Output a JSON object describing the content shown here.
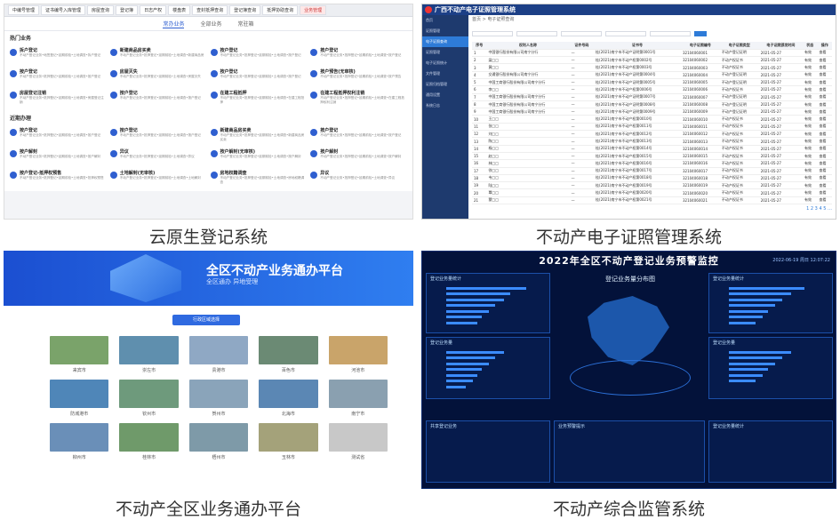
{
  "panel1": {
    "tabs": [
      "中编号管理",
      "证书编号入库管理",
      "房屋查询",
      "登记簿",
      "日志产权",
      "楼盘表",
      "查封抵押查询",
      "登记簿查询",
      "抵押协助查询",
      "业务管理"
    ],
    "subnav": [
      "常办业务",
      "全部业务",
      "常驻箱"
    ],
    "hot_title": "热门业务",
    "hot_items": [
      {
        "t": "拆户登记",
        "d": "不动产登记业务•地签登记•延期前检•土地调查•拆户登记"
      },
      {
        "t": "新建商品房买卖",
        "d": "不动产登记业务•抵押登记•延期前检•土地调查•新建商品房"
      },
      {
        "t": "按户登记",
        "d": "不动产登记业务•抵押登记•延期前检•土地调查•按户登记"
      },
      {
        "t": "按户登记",
        "d": "不动产登记业务•抵押登记•延期前检•土地调查•按户登记"
      },
      {
        "t": "按户登记",
        "d": "不动产登记业务•抵押登记•延期前检•土地调查•按户登记"
      },
      {
        "t": "房屋灭失",
        "d": "不动产登记业务•抵押登记•延期前检•土地调查•房屋灭失"
      },
      {
        "t": "按户登记",
        "d": "不动产登记业务•抵押登记•延期前检•土地调查•按户登记"
      },
      {
        "t": "按户预告(无审核)",
        "d": "不动产登记业务•抵押登记•延期前检•土地调查•按户预告"
      },
      {
        "t": "房屋登记注销",
        "d": "不动产登记业务•抵押登记•延期前检•土地调查•房屋登记注销"
      },
      {
        "t": "按户登记",
        "d": "不动产登记业务•抵押登记•延期前检•土地调查•按户登记"
      },
      {
        "t": "在建工程抵押",
        "d": "不动产登记业务•抵押登记•延期前检•土地调查•在建工程抵押"
      },
      {
        "t": "在建工程抵押权利注销",
        "d": "不动产登记业务•抵押登记•延期前检•土地调查•在建工程抵押权利注销"
      }
    ],
    "recent_title": "近期办理",
    "recent_items": [
      {
        "t": "按户登记",
        "d": "不动产登记业务•抵押登记•延期前检•土地调查•按户登记"
      },
      {
        "t": "按户登记",
        "d": "不动产登记业务•抵押登记•延期前检•土地调查•按户登记"
      },
      {
        "t": "新建商品房买卖",
        "d": "不动产登记业务•抵押登记•延期前检•土地调查•新建商品房买卖"
      },
      {
        "t": "按户登记",
        "d": "不动产登记业务•抵押登记•延期前检•土地调查•按户登记"
      },
      {
        "t": "按户解封",
        "d": "不动产登记业务•抵押登记•延期前检•土地调查•按户解封"
      },
      {
        "t": "异议",
        "d": "不动产登记业务•抵押登记•延期前检•土地调查•异议"
      },
      {
        "t": "按户解封(无审核)",
        "d": "不动产登记业务•抵押登记•延期前检•土地调查•按户解封"
      },
      {
        "t": "按户解封",
        "d": "不动产登记业务•抵押登记•延期前检•土地调查•按户解封"
      },
      {
        "t": "按户登记-抵押权预售",
        "d": "不动产登记业务•抵押登记•延期前检•土地调查•抵押权预售"
      },
      {
        "t": "土地解封(无审核)",
        "d": "不动产登记业务•抵押登记•延期前检•土地调查•土地解封"
      },
      {
        "t": "房地权籍调查",
        "d": "不动产登记业务•抵押登记•延期前检•土地调查•房地权籍调查"
      },
      {
        "t": "异议",
        "d": "不动产登记业务•抵押登记•延期前检•土地调查•异议"
      }
    ]
  },
  "panel2": {
    "title": "广西不动产电子证照管理系统",
    "side": [
      "首页",
      "证照管理",
      "电子证照查询",
      "证照管理",
      "电子证照统计",
      "文件管理",
      "证照归档管理",
      "通用设置",
      "系统日志"
    ],
    "side_active": 2,
    "crumb": "首页 > 电子证照查询",
    "headers": [
      "序号",
      "权利人名称",
      "证件号码",
      "证书号",
      "电子证照编号",
      "电子证照类型",
      "电子证照颁发时间",
      "状态",
      "操作"
    ],
    "rows": [
      [
        "1",
        "中国银行股份有限公司南宁分行",
        "—",
        "桂(2021)南宁市不动产证明第0001号",
        "32104060001",
        "不动产登记证明",
        "2021-05-27",
        "有效",
        "查看"
      ],
      [
        "2",
        "梁□□",
        "—",
        "桂(2021)南宁市不动产权第0002号",
        "32104060002",
        "不动产权证书",
        "2021-05-27",
        "有效",
        "查看"
      ],
      [
        "3",
        "黄□□",
        "—",
        "桂(2021)南宁市不动产权第0003号",
        "32104060003",
        "不动产权证书",
        "2021-05-27",
        "有效",
        "查看"
      ],
      [
        "4",
        "交通银行股份有限公司南宁分行",
        "—",
        "桂(2021)南宁市不动产证明第0004号",
        "32104060004",
        "不动产登记证明",
        "2021-05-27",
        "有效",
        "查看"
      ],
      [
        "5",
        "中国工商银行股份有限公司南宁分行",
        "—",
        "桂(2021)南宁市不动产证明第0005号",
        "32104060005",
        "不动产登记证明",
        "2021-05-27",
        "有效",
        "查看"
      ],
      [
        "6",
        "李□□",
        "—",
        "桂(2021)南宁市不动产权第0006号",
        "32104060006",
        "不动产权证书",
        "2021-05-27",
        "有效",
        "查看"
      ],
      [
        "7",
        "中国工商银行股份有限公司南宁分行",
        "—",
        "桂(2021)南宁市不动产证明第0007号",
        "32104060007",
        "不动产登记证明",
        "2021-05-27",
        "有效",
        "查看"
      ],
      [
        "8",
        "中国工商银行股份有限公司南宁分行",
        "—",
        "桂(2021)南宁市不动产证明第0008号",
        "32104060008",
        "不动产登记证明",
        "2021-05-27",
        "有效",
        "查看"
      ],
      [
        "9",
        "中国工商银行股份有限公司南宁分行",
        "—",
        "桂(2021)南宁市不动产证明第0009号",
        "32104060009",
        "不动产登记证明",
        "2021-05-27",
        "有效",
        "查看"
      ],
      [
        "10",
        "王□□",
        "—",
        "桂(2021)南宁市不动产权第0010号",
        "32104060010",
        "不动产权证书",
        "2021-05-27",
        "有效",
        "查看"
      ],
      [
        "11",
        "张□□",
        "—",
        "桂(2021)南宁市不动产权第0011号",
        "32104060011",
        "不动产权证书",
        "2021-05-27",
        "有效",
        "查看"
      ],
      [
        "12",
        "刘□□",
        "—",
        "桂(2021)南宁市不动产权第0012号",
        "32104060012",
        "不动产权证书",
        "2021-05-27",
        "有效",
        "查看"
      ],
      [
        "13",
        "陈□□",
        "—",
        "桂(2021)南宁市不动产权第0013号",
        "32104060013",
        "不动产权证书",
        "2021-05-27",
        "有效",
        "查看"
      ],
      [
        "14",
        "杨□□",
        "—",
        "桂(2021)南宁市不动产权第0014号",
        "32104060014",
        "不动产权证书",
        "2021-05-27",
        "有效",
        "查看"
      ],
      [
        "15",
        "赵□□",
        "—",
        "桂(2021)南宁市不动产权第0015号",
        "32104060015",
        "不动产权证书",
        "2021-05-27",
        "有效",
        "查看"
      ],
      [
        "16",
        "林□□",
        "—",
        "桂(2021)南宁市不动产权第0016号",
        "32104060016",
        "不动产权证书",
        "2021-05-27",
        "有效",
        "查看"
      ],
      [
        "17",
        "徐□□",
        "—",
        "桂(2021)南宁市不动产权第0017号",
        "32104060017",
        "不动产权证书",
        "2021-05-27",
        "有效",
        "查看"
      ],
      [
        "18",
        "韦□□",
        "—",
        "桂(2021)南宁市不动产权第0018号",
        "32104060018",
        "不动产权证书",
        "2021-05-27",
        "有效",
        "查看"
      ],
      [
        "19",
        "陆□□",
        "—",
        "桂(2021)南宁市不动产权第0019号",
        "32104060019",
        "不动产权证书",
        "2021-05-27",
        "有效",
        "查看"
      ],
      [
        "20",
        "覃□□",
        "—",
        "桂(2021)南宁市不动产权第0020号",
        "32104060020",
        "不动产权证书",
        "2021-05-27",
        "有效",
        "查看"
      ],
      [
        "21",
        "蒙□□",
        "—",
        "桂(2021)南宁市不动产权第0021号",
        "32104060021",
        "不动产权证书",
        "2021-05-27",
        "有效",
        "查看"
      ]
    ],
    "pager": "1 2 3 4 5 …"
  },
  "panel3": {
    "title": "全区不动产业务通办平台",
    "subtitle": "全区通办  异地受理",
    "pill": "行政区域选择",
    "cities": [
      {
        "name": "来宾市",
        "color": "#7aa36a"
      },
      {
        "name": "崇左市",
        "color": "#5f8fae"
      },
      {
        "name": "贵港市",
        "color": "#8fa8c4"
      },
      {
        "name": "百色市",
        "color": "#6b8a74"
      },
      {
        "name": "河池市",
        "color": "#c9a46a"
      },
      {
        "name": "防城港市",
        "color": "#4f86b8"
      },
      {
        "name": "钦州市",
        "color": "#6e9a7c"
      },
      {
        "name": "贺州市",
        "color": "#8aa4ba"
      },
      {
        "name": "北海市",
        "color": "#5b87b4"
      },
      {
        "name": "南宁市",
        "color": "#8aa0b0"
      },
      {
        "name": "柳州市",
        "color": "#6a8fb8"
      },
      {
        "name": "桂林市",
        "color": "#6f9a6a"
      },
      {
        "name": "梧州市",
        "color": "#7e9aa8"
      },
      {
        "name": "玉林市",
        "color": "#a4a27a"
      },
      {
        "name": "测试省",
        "color": "#c8c8c8"
      }
    ]
  },
  "panel4": {
    "title": "2022年全区不动产登记业务预警监控",
    "time": "2022-06-19 周日 12:07:22",
    "map_title": "登记业务量分布图",
    "left_boxes": [
      "登记业务量统计",
      "登记业务量",
      "共享登记业务"
    ],
    "right_boxes": [
      "登记业务量统计",
      "登记业务量",
      "登记业务量统计"
    ],
    "bottom_center": "业务预警提示",
    "left_bars": [
      0.9,
      0.72,
      0.65,
      0.55,
      0.48,
      0.4,
      0.35,
      0.3,
      0.22
    ],
    "right_bars": [
      0.85,
      0.7,
      0.6,
      0.52,
      0.44,
      0.38,
      0.3
    ]
  },
  "captions": [
    "云原生登记系统",
    "不动产电子证照管理系统",
    "不动产全区业务通办平台",
    "不动产综合监管系统"
  ]
}
